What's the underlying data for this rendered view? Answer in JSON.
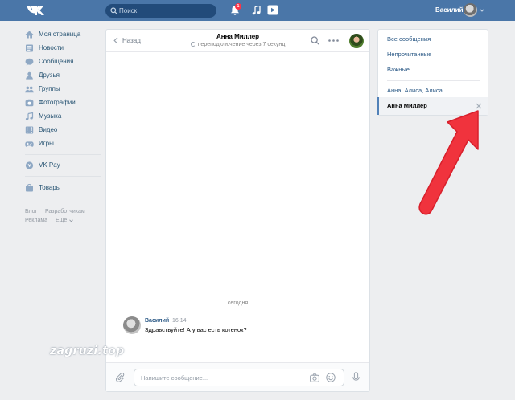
{
  "header": {
    "search_placeholder": "Поиск",
    "notif_count": "1",
    "user_name": "Василий",
    "colors": {
      "bar": "#4a76a8",
      "search_bg": "#224b7a"
    }
  },
  "left_menu": {
    "items": [
      {
        "label": "Моя страница",
        "icon": "home-icon"
      },
      {
        "label": "Новости",
        "icon": "news-icon"
      },
      {
        "label": "Сообщения",
        "icon": "messages-icon"
      },
      {
        "label": "Друзья",
        "icon": "friends-icon"
      },
      {
        "label": "Группы",
        "icon": "groups-icon"
      },
      {
        "label": "Фотографии",
        "icon": "photos-icon"
      },
      {
        "label": "Музыка",
        "icon": "music-icon"
      },
      {
        "label": "Видео",
        "icon": "video-icon"
      },
      {
        "label": "Игры",
        "icon": "games-icon"
      }
    ],
    "vkpay": "VK Pay",
    "goods": "Товары",
    "footer": {
      "blog": "Блог",
      "dev": "Разработчикам",
      "ads": "Реклама",
      "more": "Ещё"
    }
  },
  "chat": {
    "back_label": "Назад",
    "title": "Анна Миллер",
    "subtitle": "переподключение через 7 секунд",
    "date_divider": "сегодня",
    "message": {
      "author": "Василий",
      "time": "16:14",
      "text": "Здравствуйте! А у вас есть котенок?"
    },
    "compose_placeholder": "Напишите сообщение..."
  },
  "right_panel": {
    "filters": [
      "Все сообщения",
      "Непрочитанные",
      "Важные"
    ],
    "conversations": [
      "Анна, Алиса, Алиса"
    ],
    "active": "Анна Миллер"
  },
  "watermark": "zagruzi.top",
  "annotation": {
    "arrow_color": "#f0333d"
  }
}
